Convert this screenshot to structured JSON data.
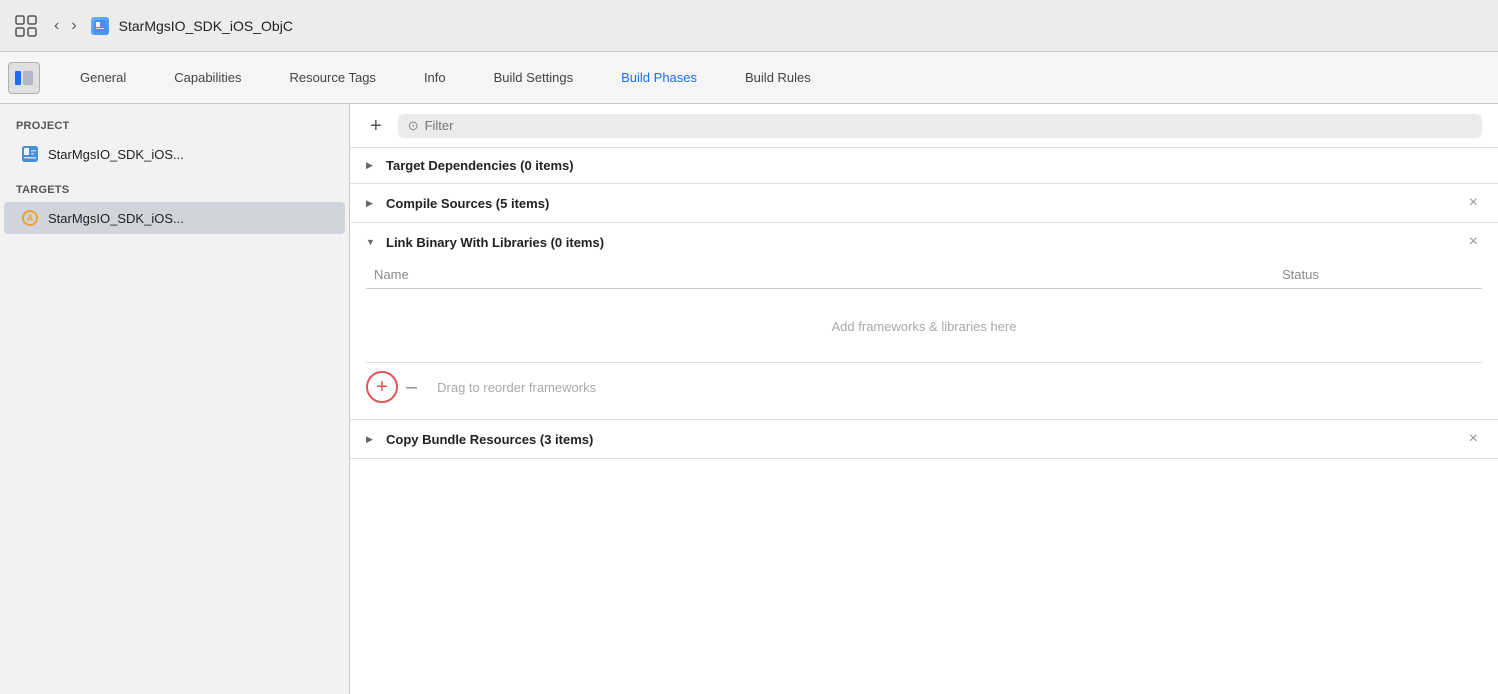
{
  "titlebar": {
    "back_label": "‹",
    "forward_label": "›",
    "title": "StarMgsIO_SDK_iOS_ObjC",
    "file_icon_label": "■"
  },
  "tabbar": {
    "tabs": [
      {
        "id": "general",
        "label": "General",
        "active": false
      },
      {
        "id": "capabilities",
        "label": "Capabilities",
        "active": false
      },
      {
        "id": "resource-tags",
        "label": "Resource Tags",
        "active": false
      },
      {
        "id": "info",
        "label": "Info",
        "active": false
      },
      {
        "id": "build-settings",
        "label": "Build Settings",
        "active": false
      },
      {
        "id": "build-phases",
        "label": "Build Phases",
        "active": true
      },
      {
        "id": "build-rules",
        "label": "Build Rules",
        "active": false
      }
    ]
  },
  "sidebar": {
    "project_header": "PROJECT",
    "project_item": "StarMgsIO_SDK_iOS...",
    "targets_header": "TARGETS",
    "target_item": "StarMgsIO_SDK_iOS..."
  },
  "content": {
    "add_button": "+",
    "filter_placeholder": "Filter",
    "phases": [
      {
        "id": "target-dependencies",
        "title": "Target Dependencies (0 items)",
        "expanded": false,
        "has_close": false
      },
      {
        "id": "compile-sources",
        "title": "Compile Sources (5 items)",
        "expanded": false,
        "has_close": true
      },
      {
        "id": "link-binary",
        "title": "Link Binary With Libraries (0 items)",
        "expanded": true,
        "has_close": true,
        "table": {
          "col_name": "Name",
          "col_status": "Status",
          "empty_label": "Add frameworks & libraries here"
        },
        "add_row": {
          "drag_hint": "Drag to reorder frameworks"
        }
      },
      {
        "id": "copy-bundle",
        "title": "Copy Bundle Resources (3 items)",
        "expanded": false,
        "has_close": true
      }
    ]
  },
  "icons": {
    "filter_symbol": "⊙",
    "chevron_right": "▶",
    "chevron_down": "▼",
    "close_x": "×",
    "plus": "+",
    "minus": "–"
  }
}
